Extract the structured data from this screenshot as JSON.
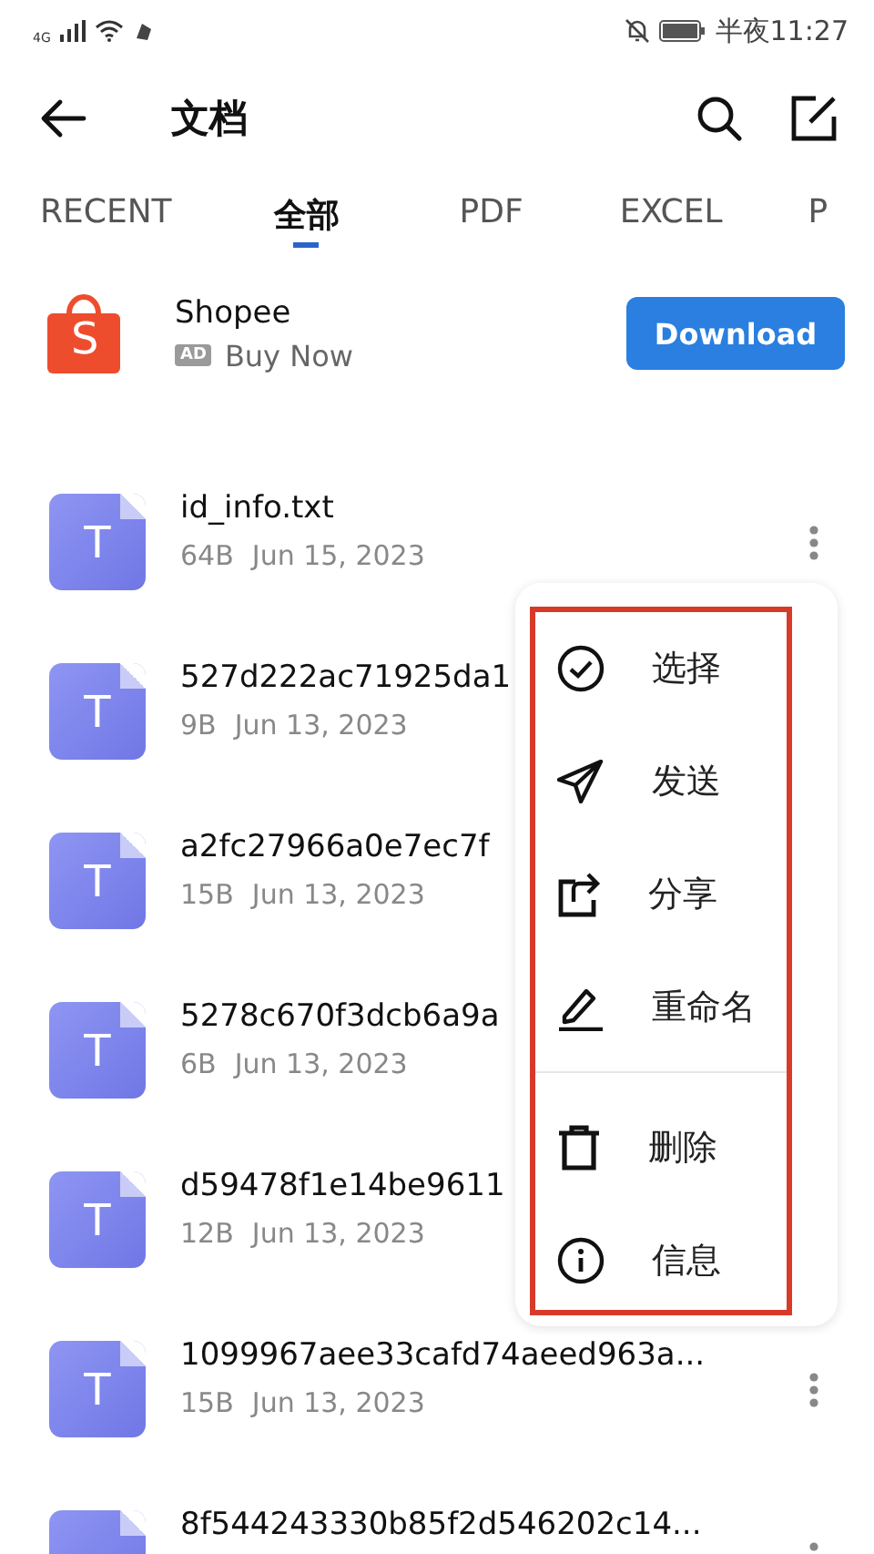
{
  "status_bar": {
    "network": "4G",
    "time": "半夜11:27"
  },
  "toolbar": {
    "title": "文档"
  },
  "tabs": [
    {
      "label": "RECENT",
      "selected": false
    },
    {
      "label": "全部",
      "selected": true
    },
    {
      "label": "PDF",
      "selected": false
    },
    {
      "label": "EXCEL",
      "selected": false
    },
    {
      "label": "P",
      "selected": false
    }
  ],
  "ad": {
    "name": "Shopee",
    "logo_letter": "S",
    "badge": "AD",
    "subtitle": "Buy Now",
    "button": "Download"
  },
  "files": [
    {
      "icon_letter": "T",
      "name": "id_info.txt",
      "size": "64B",
      "date": "Jun 15, 2023",
      "more_icon": true
    },
    {
      "icon_letter": "T",
      "name": "527d222ac71925da1",
      "size": "9B",
      "date": "Jun 13, 2023",
      "more_icon": false
    },
    {
      "icon_letter": "T",
      "name": "a2fc27966a0e7ec7f",
      "size": "15B",
      "date": "Jun 13, 2023",
      "more_icon": false
    },
    {
      "icon_letter": "T",
      "name": "5278c670f3dcb6a9a",
      "size": "6B",
      "date": "Jun 13, 2023",
      "more_icon": false
    },
    {
      "icon_letter": "T",
      "name": "d59478f1e14be9611",
      "size": "12B",
      "date": "Jun 13, 2023",
      "more_icon": false
    },
    {
      "icon_letter": "T",
      "name": "1099967aee33cafd74aeed963a...",
      "size": "15B",
      "date": "Jun 13, 2023",
      "more_icon": true
    },
    {
      "name": "8f544243330b85f2d546202c14...",
      "more_icon": true
    }
  ],
  "context_menu": {
    "highlighted": true,
    "items": [
      {
        "kind": "select",
        "label": "选择",
        "divider_before": false
      },
      {
        "kind": "send",
        "label": "发送",
        "divider_before": false
      },
      {
        "kind": "share",
        "label": "分享",
        "divider_before": false
      },
      {
        "kind": "rename",
        "label": "重命名",
        "divider_before": false
      },
      {
        "kind": "delete",
        "label": "删除",
        "divider_before": true
      },
      {
        "kind": "info",
        "label": "信息",
        "divider_before": false
      }
    ]
  }
}
